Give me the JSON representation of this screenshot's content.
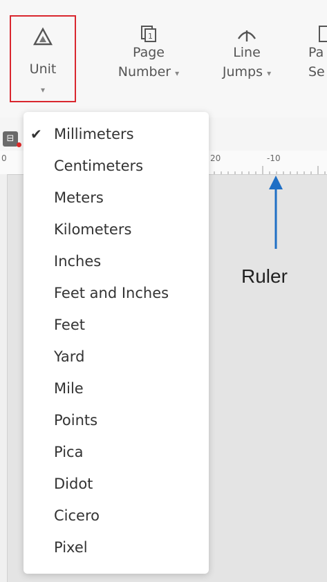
{
  "toolbar": {
    "unit": {
      "label": "Unit"
    },
    "page_number": {
      "label_line1": "Page",
      "label_line2": "Number"
    },
    "line_jumps": {
      "label_line1": "Line",
      "label_line2": "Jumps"
    },
    "partial": {
      "label_line1": "Pa",
      "label_line2": "Se"
    }
  },
  "ruler": {
    "ticks": [
      "0",
      "20",
      "-10"
    ]
  },
  "annotation": {
    "text": "Ruler"
  },
  "menu": {
    "selected": "Millimeters",
    "items": [
      "Millimeters",
      "Centimeters",
      "Meters",
      "Kilometers",
      "Inches",
      "Feet and Inches",
      "Feet",
      "Yard",
      "Mile",
      "Points",
      "Pica",
      "Didot",
      "Cicero",
      "Pixel"
    ]
  }
}
